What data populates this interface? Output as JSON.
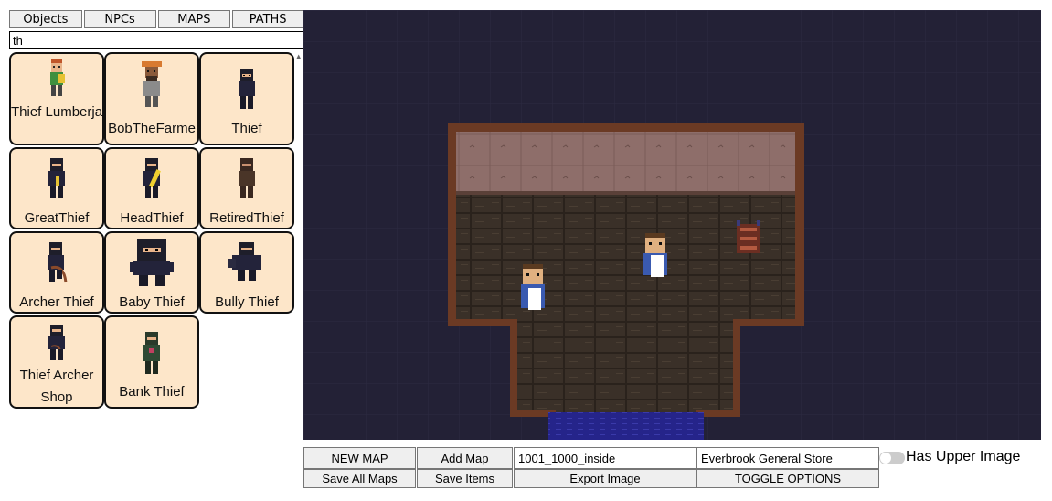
{
  "tabs": [
    {
      "label": "Objects"
    },
    {
      "label": "NPCs"
    },
    {
      "label": "MAPS"
    },
    {
      "label": "PATHS"
    }
  ],
  "search": {
    "value": "th"
  },
  "results": [
    {
      "name": "Thief Lumberjack",
      "icon": "lumberjack-thief-sprite"
    },
    {
      "name": "BobTheFarme",
      "icon": "farmer-sprite"
    },
    {
      "name": "Thief",
      "icon": "thief-sprite"
    },
    {
      "name": "GreatThief",
      "icon": "great-thief-sprite"
    },
    {
      "name": "HeadThief",
      "icon": "head-thief-sprite"
    },
    {
      "name": "RetiredThief",
      "icon": "retired-thief-sprite"
    },
    {
      "name": "Archer Thief",
      "icon": "archer-thief-sprite"
    },
    {
      "name": "Baby Thief",
      "icon": "baby-thief-sprite"
    },
    {
      "name": "Bully Thief",
      "icon": "bully-thief-sprite"
    },
    {
      "name": "Thief Archer Shop",
      "icon": "thief-archer-shop-sprite"
    },
    {
      "name": "Bank Thief",
      "icon": "bank-thief-sprite"
    }
  ],
  "map": {
    "background": "#232136",
    "wall_color": "#6b3a24",
    "floor_color": "#3b3026",
    "water_color": "#2a2a7a"
  },
  "toolbar": {
    "new_map": "NEW MAP",
    "add_map": "Add Map",
    "map_id": "1001_1000_inside",
    "map_name": "Everbrook General Store",
    "has_upper_image": "Has Upper Image",
    "save_all_maps": "Save All Maps",
    "save_items": "Save Items",
    "export_image": "Export Image",
    "toggle_options": "TOGGLE OPTIONS"
  }
}
